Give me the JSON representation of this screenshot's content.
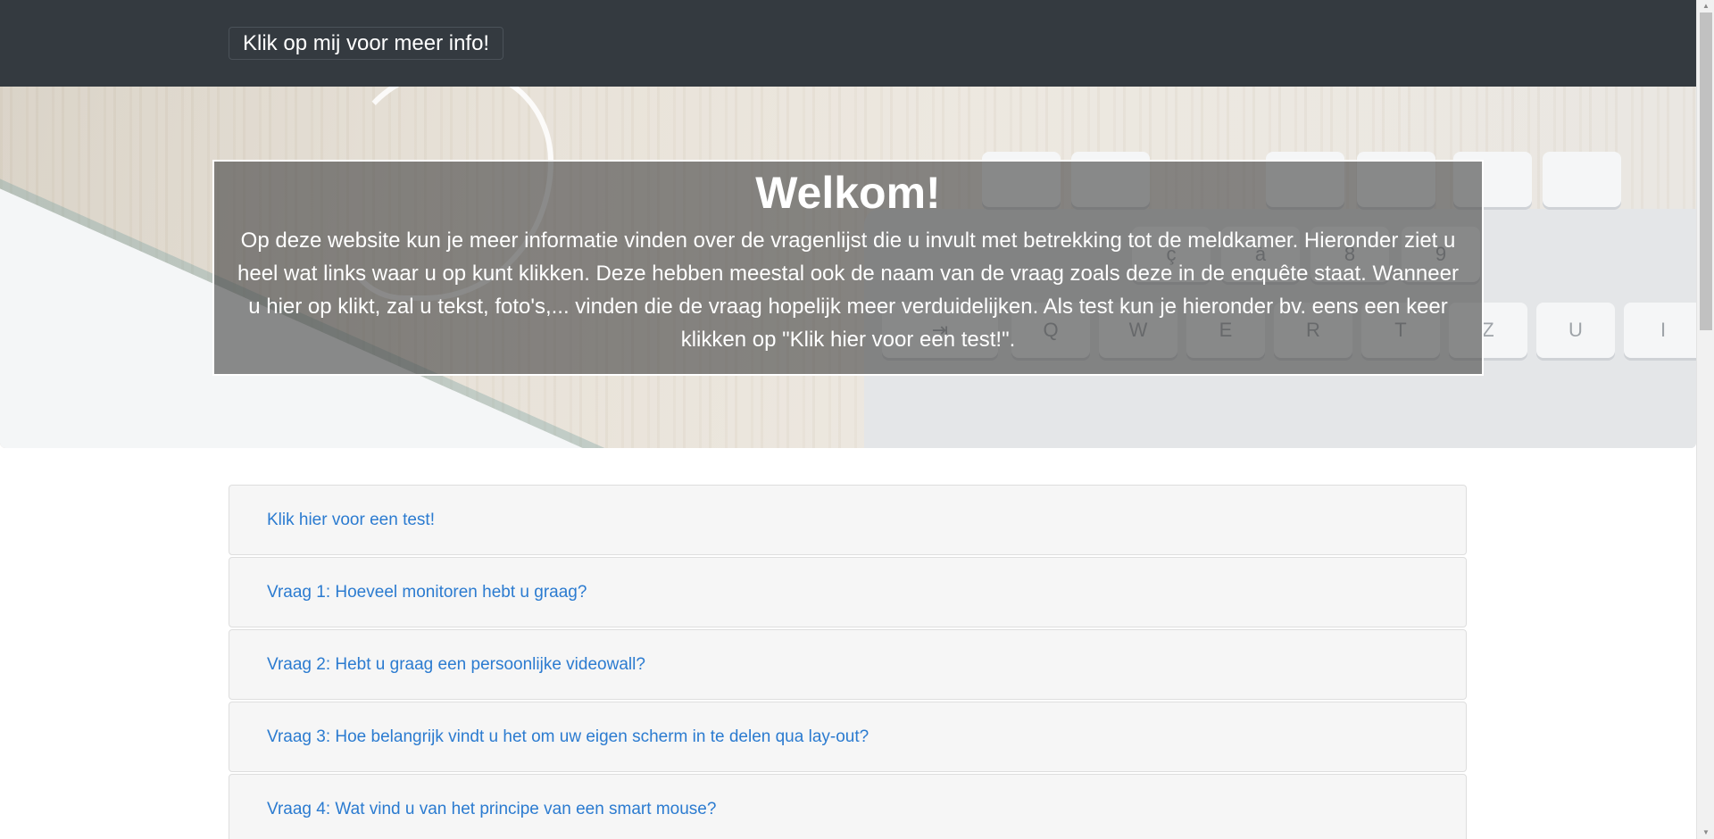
{
  "navbar": {
    "brand_button": "Klik op mij voor meer info!"
  },
  "hero": {
    "title": "Welkom!",
    "text": "Op deze website kun je meer informatie vinden over de vragenlijst die u invult met betrekking tot de meldkamer. Hieronder ziet u heel wat links waar u op kunt klikken. Deze hebben meestal ook de naam van de vraag zoals deze in de enquête staat. Wanneer u hier op klikt, zal u tekst, foto's,... vinden die de vraag hopelijk meer verduidelijken. Als test kun je hieronder bv. eens een keer klikken op \"Klik hier voor een test!\"."
  },
  "keyboard_keys": [
    "Q",
    "W",
    "E",
    "R",
    "T",
    "Z",
    "U",
    "I",
    "8",
    "9",
    "à",
    "ç"
  ],
  "accordion": {
    "items": [
      {
        "label": "Klik hier voor een test!"
      },
      {
        "label": "Vraag 1: Hoeveel monitoren hebt u graag?"
      },
      {
        "label": "Vraag 2: Hebt u graag een persoonlijke videowall?"
      },
      {
        "label": "Vraag 3: Hoe belangrijk vindt u het om uw eigen scherm in te delen qua lay-out?"
      },
      {
        "label": "Vraag 4: Wat vind u van het principe van een smart mouse?"
      }
    ]
  },
  "colors": {
    "navbar": "#343a40",
    "link": "#2b7bd0",
    "item_bg": "#f6f6f6"
  }
}
